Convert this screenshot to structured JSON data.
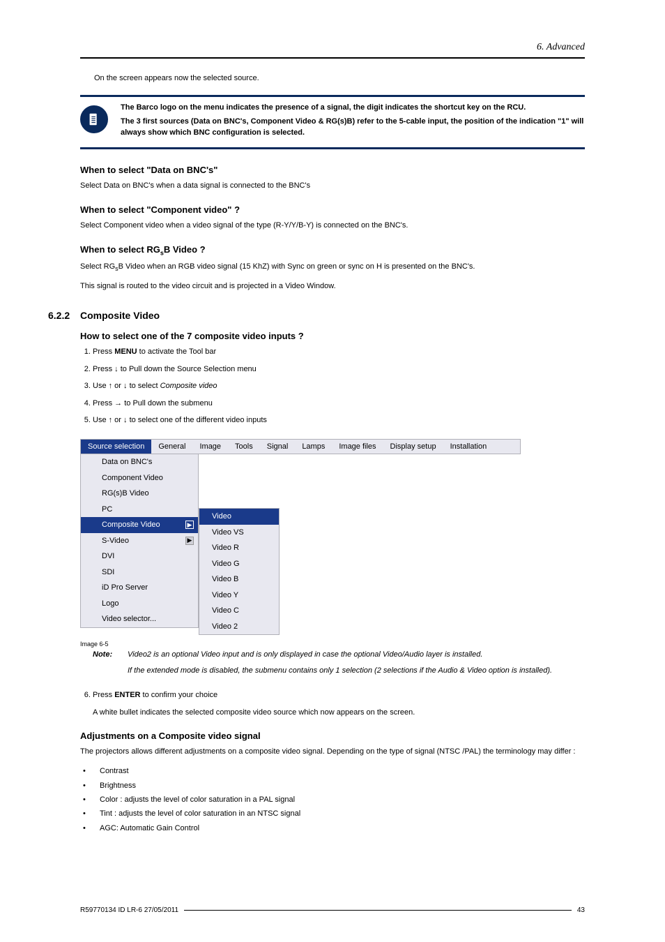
{
  "header": {
    "chapter": "6. Advanced"
  },
  "intro": "On the screen appears now the selected source.",
  "noteBox": {
    "line1": "The Barco logo on the menu indicates the presence of a signal, the digit indicates the shortcut key on the RCU.",
    "line2": "The 3 first sources (Data on BNC's, Component Video & RG(s)B) refer to the 5-cable input, the position of the indication \"1\" will always show which BNC configuration is selected."
  },
  "sec1": {
    "title": "When to select \"Data on BNC's\"",
    "body": "Select Data on BNC's when a data signal is connected to the BNC's"
  },
  "sec2": {
    "title": "When to select \"Component video\" ?",
    "body": "Select Component video when a video signal of the type (R-Y/Y/B-Y) is connected on the BNC's."
  },
  "sec3": {
    "title_pre": "When to select RG",
    "title_sub": "s",
    "title_post": "B Video ?",
    "body1_pre": "Select RG",
    "body1_sub": "s",
    "body1_post": "B Video when an RGB video signal (15 KhZ) with Sync on green or sync on H is presented on the BNC's.",
    "body2": "This signal is routed to the video circuit and is projected in a Video Window."
  },
  "section622": {
    "number": "6.2.2",
    "title": "Composite Video",
    "howto_title": "How to select one of the 7 composite video inputs ?",
    "steps": {
      "s1_pre": "Press ",
      "s1_bold": "MENU",
      "s1_post": " to activate the Tool bar",
      "s2": "Press ↓ to Pull down the Source Selection menu",
      "s3_pre": "Use ↑ or ↓ to select ",
      "s3_it": "Composite video",
      "s4": "Press → to Pull down the submenu",
      "s5": "Use ↑ or ↓ to select one of the different video inputs"
    }
  },
  "menu": {
    "bar": [
      "Source selection",
      "General",
      "Image",
      "Tools",
      "Signal",
      "Lamps",
      "Image files",
      "Display setup",
      "Installation"
    ],
    "items": [
      "Data on BNC's",
      "Component Video",
      "RG(s)B Video",
      "PC",
      "Composite Video",
      "S-Video",
      "DVI",
      "SDI",
      "iD Pro Server",
      "Logo",
      "Video selector..."
    ],
    "sub": [
      "Video",
      "Video VS",
      "Video R",
      "Video G",
      "Video B",
      "Video Y",
      "Video C",
      "Video 2"
    ]
  },
  "imageCaption": "Image 6-5",
  "note": {
    "label": "Note:",
    "p1": "Video2 is an optional Video input and is only displayed in case the optional Video/Audio layer is installed.",
    "p2": "If the extended mode is disabled, the submenu contains only 1 selection (2 selections if the Audio & Video option is installed)."
  },
  "step6": {
    "pre": "Press ",
    "bold": "ENTER",
    "post": " to confirm your choice",
    "below": "A white bullet indicates the selected composite video source which now appears on the screen."
  },
  "adjustments": {
    "title": "Adjustments on a Composite video signal",
    "intro": "The projectors allows different adjustments on a composite video signal. Depending on the type of signal (NTSC /PAL) the terminology may differ :",
    "items": [
      "Contrast",
      "Brightness",
      "Color : adjusts the level of color saturation in a PAL signal",
      "Tint : adjusts the level of color saturation in an NTSC signal",
      "AGC: Automatic Gain Control"
    ]
  },
  "footer": {
    "left": "R59770134  ID LR-6  27/05/2011",
    "right": "43"
  }
}
